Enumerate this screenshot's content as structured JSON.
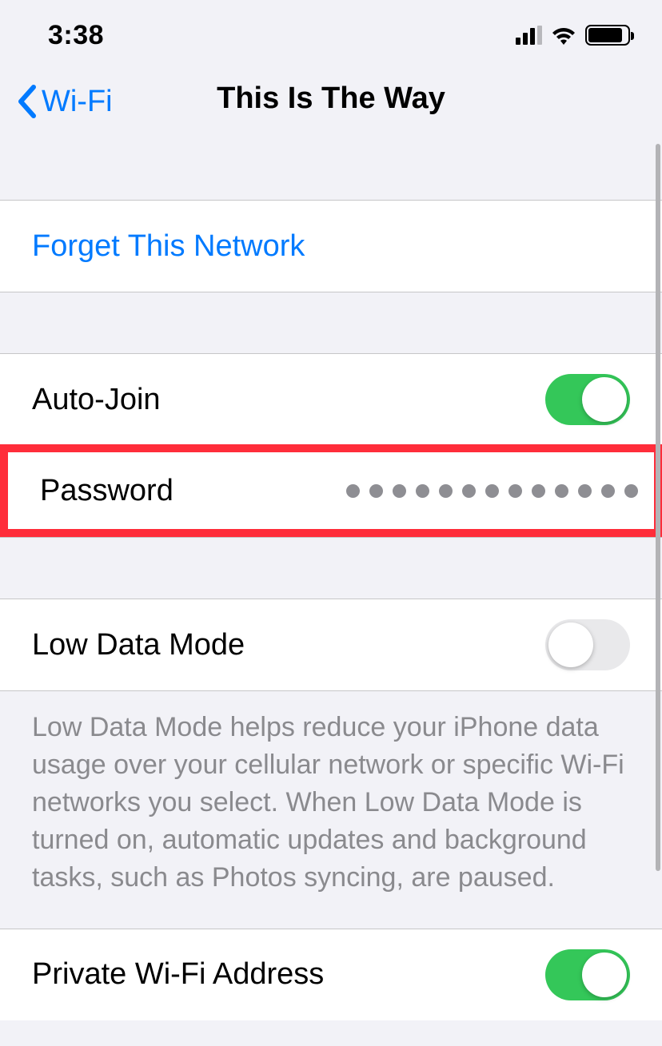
{
  "status": {
    "time": "3:38"
  },
  "nav": {
    "back_label": "Wi-Fi",
    "title": "This Is The Way"
  },
  "rows": {
    "forget": "Forget This Network",
    "autojoin_label": "Auto-Join",
    "password_label": "Password",
    "password_dot_count": 13,
    "lowdata_label": "Low Data Mode",
    "lowdata_footer": "Low Data Mode helps reduce your iPhone data usage over your cellular network or specific Wi-Fi networks you select. When Low Data Mode is turned on, automatic updates and background tasks, such as Photos syncing, are paused.",
    "private_label": "Private Wi-Fi Address"
  },
  "switches": {
    "autojoin": true,
    "lowdata": false,
    "private": true
  }
}
